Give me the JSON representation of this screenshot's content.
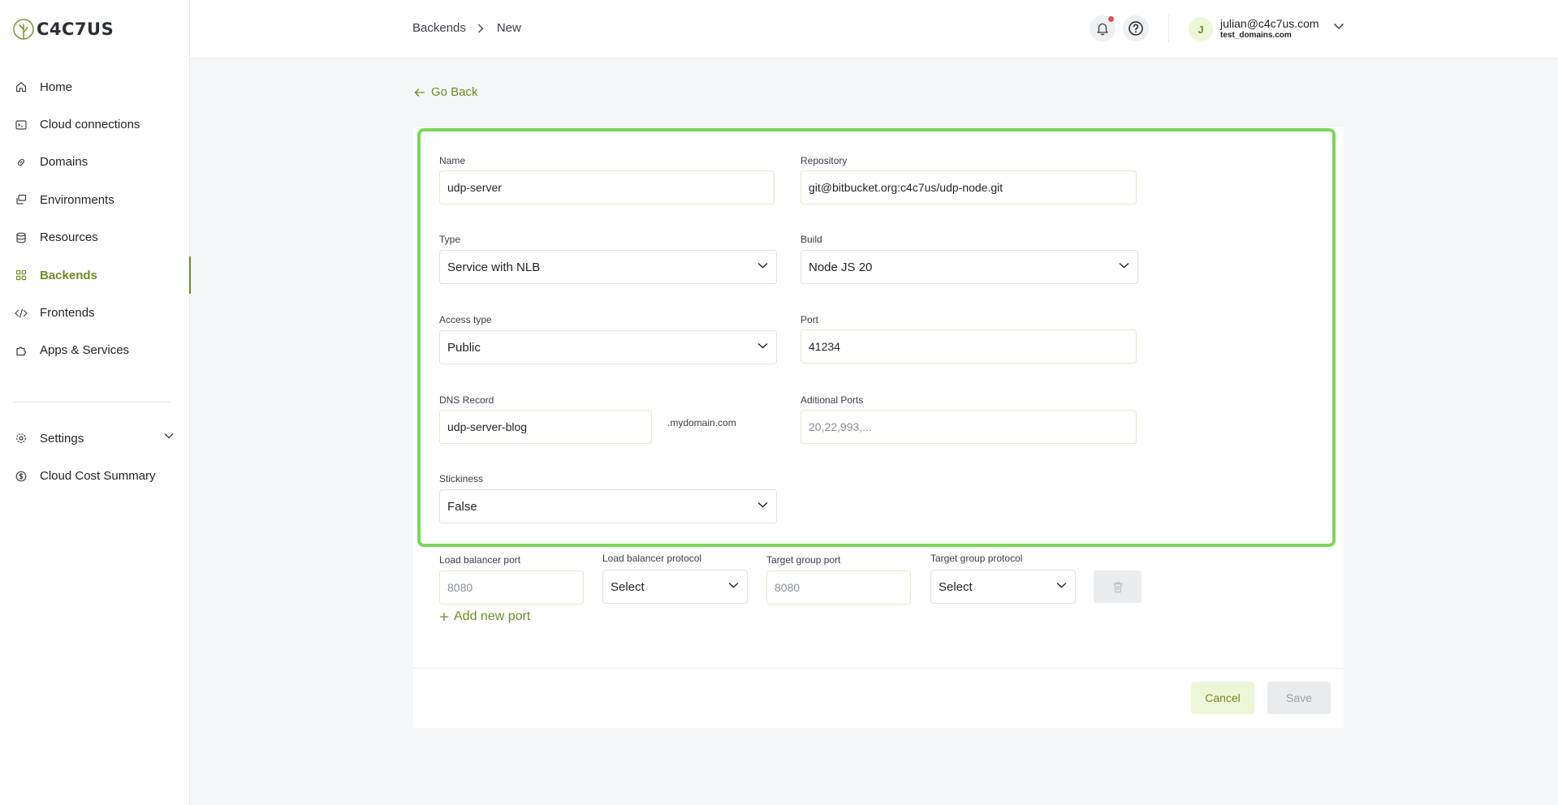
{
  "brand": {
    "name": "C4C7US",
    "accent": "#6b8e23",
    "highlight": "#7bd65a"
  },
  "sidebar": {
    "items": [
      {
        "label": "Home",
        "icon": "home-icon"
      },
      {
        "label": "Cloud connections",
        "icon": "terminal-icon"
      },
      {
        "label": "Domains",
        "icon": "link-icon"
      },
      {
        "label": "Environments",
        "icon": "layers-icon"
      },
      {
        "label": "Resources",
        "icon": "database-icon"
      },
      {
        "label": "Backends",
        "icon": "grid-icon",
        "active": true
      },
      {
        "label": "Frontends",
        "icon": "code-icon"
      },
      {
        "label": "Apps & Services",
        "icon": "puzzle-icon"
      }
    ],
    "bottom_items": [
      {
        "label": "Settings",
        "icon": "gear-icon"
      },
      {
        "label": "Cloud Cost Summary",
        "icon": "dollar-icon"
      }
    ]
  },
  "header": {
    "breadcrumb": [
      "Backends",
      "New"
    ],
    "user": {
      "initial": "J",
      "email": "julian@c4c7us.com",
      "domain": "test_domains.com"
    }
  },
  "form": {
    "go_back": "Go Back",
    "name": {
      "label": "Name",
      "value": "udp-server"
    },
    "repository": {
      "label": "Repository",
      "value": "git@bitbucket.org:c4c7us/udp-node.git"
    },
    "type": {
      "label": "Type",
      "value": "Service with NLB"
    },
    "build": {
      "label": "Build",
      "value": "Node JS 20"
    },
    "access_type": {
      "label": "Access type",
      "value": "Public"
    },
    "port": {
      "label": "Port",
      "value": "41234"
    },
    "dns_record": {
      "label": "DNS Record",
      "value": "udp-server-blog",
      "suffix": ".mydomain.com"
    },
    "additional_ports": {
      "label": "Aditional Ports",
      "placeholder": "20,22,993,..."
    },
    "stickiness": {
      "label": "Stickiness",
      "value": "False"
    },
    "ports_row": {
      "lb_port": {
        "label": "Load balancer port",
        "placeholder": "8080"
      },
      "lb_protocol": {
        "label": "Load balancer protocol",
        "value": "Select"
      },
      "tg_port": {
        "label": "Target group port",
        "placeholder": "8080"
      },
      "tg_protocol": {
        "label": "Target group protocol",
        "value": "Select"
      }
    },
    "add_port": "Add new port",
    "cancel": "Cancel",
    "save": "Save"
  }
}
